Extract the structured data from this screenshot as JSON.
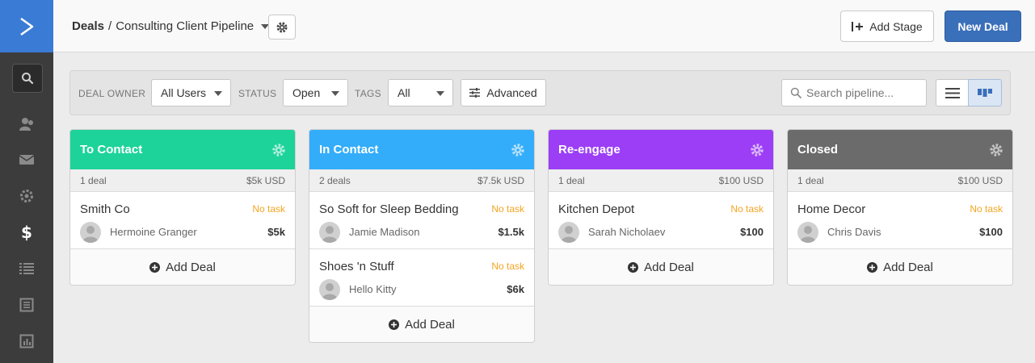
{
  "breadcrumb": {
    "root": "Deals",
    "separator": "/",
    "pipeline": "Consulting Client Pipeline"
  },
  "header": {
    "add_stage_label": "Add Stage",
    "new_deal_label": "New Deal"
  },
  "filters": {
    "deal_owner_label": "DEAL OWNER",
    "deal_owner_value": "All Users",
    "status_label": "STATUS",
    "status_value": "Open",
    "tags_label": "TAGS",
    "tags_value": "All",
    "advanced_label": "Advanced",
    "search_placeholder": "Search pipeline..."
  },
  "colors": {
    "brand": "#3a7bd5",
    "primary": "#3a6fba",
    "task": "#f4a522"
  },
  "stages": [
    {
      "name": "To Contact",
      "color": "#1dd39a",
      "count": "1 deal",
      "total": "$5k USD",
      "deals": [
        {
          "title": "Smith Co",
          "task": "No task",
          "owner": "Hermoine Granger",
          "value": "$5k"
        }
      ],
      "add_label": "Add Deal"
    },
    {
      "name": "In Contact",
      "color": "#33adf9",
      "count": "2 deals",
      "total": "$7.5k USD",
      "deals": [
        {
          "title": "So Soft for Sleep Bedding",
          "task": "No task",
          "owner": "Jamie Madison",
          "value": "$1.5k"
        },
        {
          "title": "Shoes 'n Stuff",
          "task": "No task",
          "owner": "Hello Kitty",
          "value": "$6k"
        }
      ],
      "add_label": "Add Deal"
    },
    {
      "name": "Re-engage",
      "color": "#9b3ef5",
      "count": "1 deal",
      "total": "$100 USD",
      "deals": [
        {
          "title": "Kitchen Depot",
          "task": "No task",
          "owner": "Sarah Nicholaev",
          "value": "$100"
        }
      ],
      "add_label": "Add Deal"
    },
    {
      "name": "Closed",
      "color": "#6b6b6b",
      "count": "1 deal",
      "total": "$100 USD",
      "deals": [
        {
          "title": "Home Decor",
          "task": "No task",
          "owner": "Chris Davis",
          "value": "$100"
        }
      ],
      "add_label": "Add Deal"
    }
  ]
}
